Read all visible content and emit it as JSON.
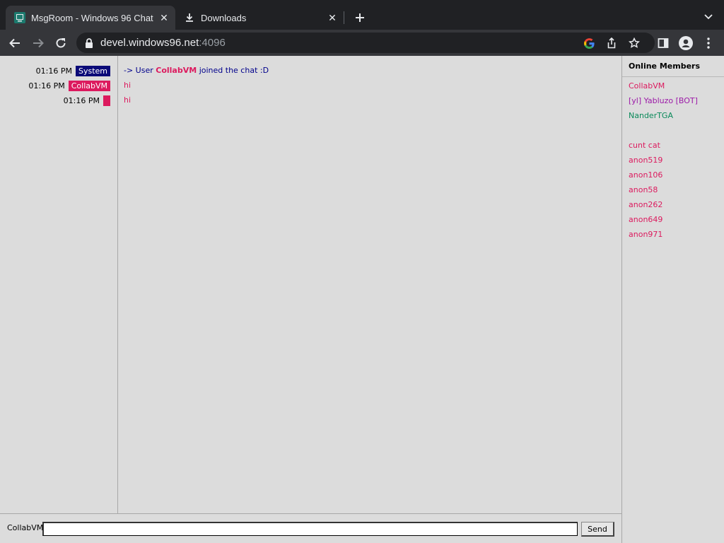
{
  "browser": {
    "tabs": [
      {
        "title": "MsgRoom - Windows 96 Chat",
        "active": true,
        "icon": "windows96-favicon"
      },
      {
        "title": "Downloads",
        "active": false,
        "icon": "download-icon"
      }
    ],
    "url_host": "devel.windows96.net",
    "url_port": ":4096"
  },
  "chat": {
    "meta": [
      {
        "time": "01:16 PM",
        "user": "System",
        "color": "#0a0a78"
      },
      {
        "time": "01:16 PM",
        "user": "CollabVM",
        "color": "#dc1a5e"
      },
      {
        "time": "01:16 PM",
        "user": "",
        "color": "#dc1a5e"
      }
    ],
    "system_prefix": "-> User ",
    "system_user": "CollabVM",
    "system_suffix": " joined the chat :D",
    "messages": [
      "hi",
      "hi"
    ]
  },
  "members": {
    "heading": "Online Members",
    "list": [
      {
        "name": "CollabVM",
        "color": "#dc1a5e"
      },
      {
        "name": "[yl] Yabluzo [BOT]",
        "color": "#9c1aa8"
      },
      {
        "name": "NanderTGA",
        "color": "#0a8a5a"
      },
      {
        "name": "",
        "color": "#dc1a5e"
      },
      {
        "name": "cunt cat",
        "color": "#dc1a5e"
      },
      {
        "name": "anon519",
        "color": "#dc1a5e"
      },
      {
        "name": "anon106",
        "color": "#dc1a5e"
      },
      {
        "name": "anon58",
        "color": "#dc1a5e"
      },
      {
        "name": "anon262",
        "color": "#dc1a5e"
      },
      {
        "name": "anon649",
        "color": "#dc1a5e"
      },
      {
        "name": "anon971",
        "color": "#dc1a5e"
      }
    ]
  },
  "input": {
    "nickname": "CollabVM",
    "value": "",
    "send_label": "Send"
  }
}
